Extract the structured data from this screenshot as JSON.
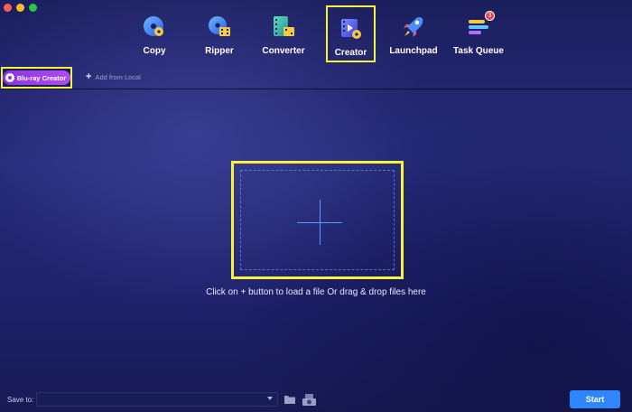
{
  "window": {
    "controls": [
      "close",
      "minimize",
      "zoom"
    ]
  },
  "nav": {
    "items": [
      {
        "label": "Copy",
        "icon": "copy-disc-icon"
      },
      {
        "label": "Ripper",
        "icon": "ripper-disc-icon"
      },
      {
        "label": "Converter",
        "icon": "converter-film-icon"
      },
      {
        "label": "Creator",
        "icon": "creator-film-icon",
        "active": true
      },
      {
        "label": "Launchpad",
        "icon": "rocket-icon"
      },
      {
        "label": "Task Queue",
        "icon": "task-queue-icon",
        "badge": "3"
      }
    ]
  },
  "toolbar": {
    "mode_label": "Blu-ray Creator",
    "add_local_label": "Add from Local"
  },
  "dropzone": {
    "hint": "Click on + button to load a file Or drag & drop files here"
  },
  "footer": {
    "save_to_label": "Save to:",
    "save_to_value": "",
    "start_label": "Start"
  },
  "colors": {
    "highlight": "#f7f33c",
    "accent_blue": "#2f86ff",
    "mode_purple": "#9b3fe8",
    "background": "#1c1f5e"
  }
}
